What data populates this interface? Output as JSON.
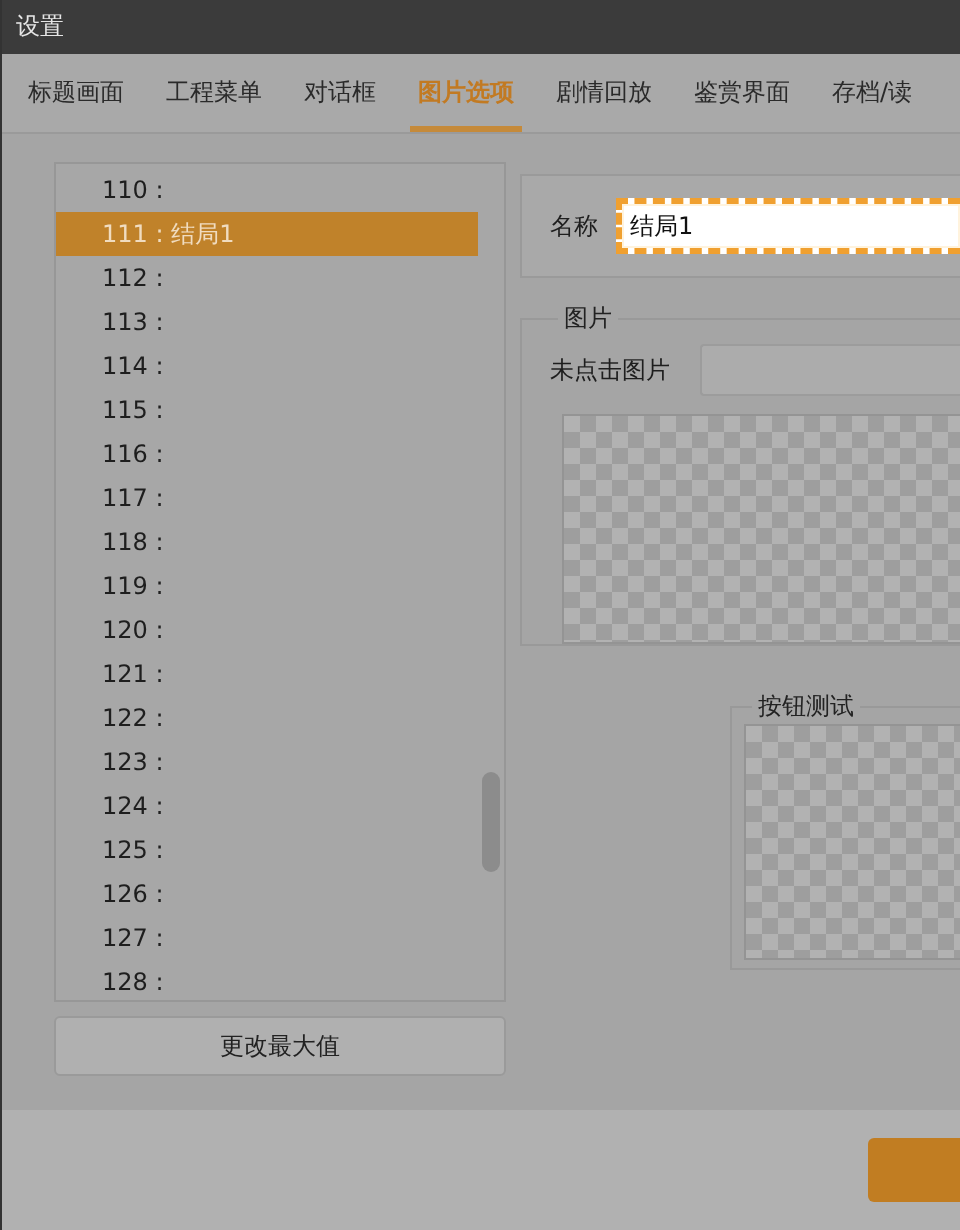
{
  "window": {
    "title": "设置"
  },
  "tabs": [
    {
      "label": "标题画面",
      "selected": false
    },
    {
      "label": "工程菜单",
      "selected": false
    },
    {
      "label": "对话框",
      "selected": false
    },
    {
      "label": "图片选项",
      "selected": true
    },
    {
      "label": "剧情回放",
      "selected": false
    },
    {
      "label": "鉴赏界面",
      "selected": false
    },
    {
      "label": "存档/读",
      "selected": false
    }
  ],
  "list": {
    "items": [
      {
        "label": "110 :",
        "selected": false
      },
      {
        "label": "111 : 结局1",
        "selected": true
      },
      {
        "label": "112 :",
        "selected": false
      },
      {
        "label": "113 :",
        "selected": false
      },
      {
        "label": "114 :",
        "selected": false
      },
      {
        "label": "115 :",
        "selected": false
      },
      {
        "label": "116 :",
        "selected": false
      },
      {
        "label": "117 :",
        "selected": false
      },
      {
        "label": "118 :",
        "selected": false
      },
      {
        "label": "119 :",
        "selected": false
      },
      {
        "label": "120 :",
        "selected": false
      },
      {
        "label": "121 :",
        "selected": false
      },
      {
        "label": "122 :",
        "selected": false
      },
      {
        "label": "123 :",
        "selected": false
      },
      {
        "label": "124 :",
        "selected": false
      },
      {
        "label": "125 :",
        "selected": false
      },
      {
        "label": "126 :",
        "selected": false
      },
      {
        "label": "127 :",
        "selected": false
      },
      {
        "label": "128 :",
        "selected": false
      }
    ],
    "button": "更改最大值"
  },
  "name_field": {
    "label": "名称",
    "value": "结局1",
    "focused": true
  },
  "image_group": {
    "title": "图片",
    "field_label": "未点击图片"
  },
  "button_test": {
    "title": "按钮测试"
  }
}
